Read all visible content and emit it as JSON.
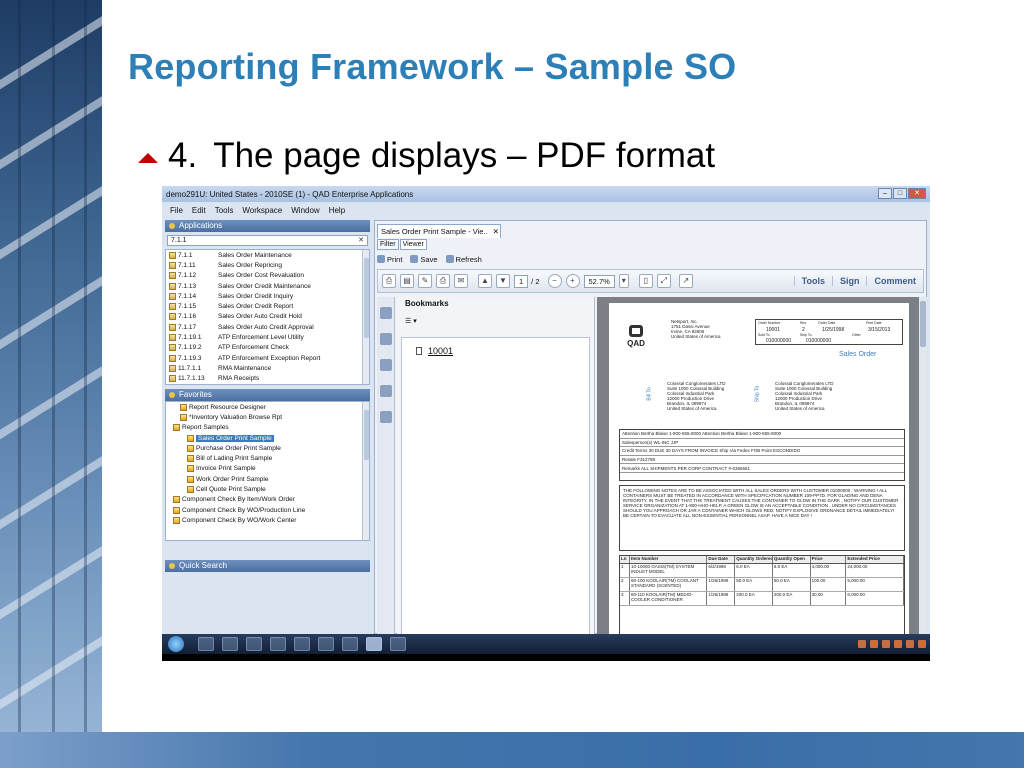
{
  "slide": {
    "title": "Reporting Framework – Sample SO",
    "bullet_number": "4.",
    "bullet_text": "The page displays – PDF format"
  },
  "app": {
    "window_title": "demo291U: United States - 2010SE (1) - QAD Enterprise Applications",
    "menu": [
      "File",
      "Edit",
      "Tools",
      "Workspace",
      "Window",
      "Help"
    ],
    "applications_header": "Applications",
    "search_value": "7.1.1",
    "applications": [
      {
        "code": "7.1.1",
        "label": "Sales Order Maintenance"
      },
      {
        "code": "7.1.11",
        "label": "Sales Order Repricing"
      },
      {
        "code": "7.1.12",
        "label": "Sales Order Cost Revaluation"
      },
      {
        "code": "7.1.13",
        "label": "Sales Order Credit Maintenance"
      },
      {
        "code": "7.1.14",
        "label": "Sales Order Credit Inquiry"
      },
      {
        "code": "7.1.15",
        "label": "Sales Order Credit Report"
      },
      {
        "code": "7.1.16",
        "label": "Sales Order Auto Credit Hold"
      },
      {
        "code": "7.1.17",
        "label": "Sales Order Auto Credit Approval"
      },
      {
        "code": "7.1.19.1",
        "label": "ATP Enforcement Level Utility"
      },
      {
        "code": "7.1.19.2",
        "label": "ATP Enforcement Check"
      },
      {
        "code": "7.1.19.3",
        "label": "ATP Enforcement Exception Report"
      },
      {
        "code": "11.7.1.1",
        "label": "RMA Maintenance"
      },
      {
        "code": "11.7.1.13",
        "label": "RMA Receipts"
      }
    ],
    "favorites_header": "Favorites",
    "favorites": [
      {
        "label": "Report Resource Designer",
        "indent": 1
      },
      {
        "label": "*Inventory Valuation Browse Rpt",
        "indent": 1
      },
      {
        "label": "Report Samples",
        "indent": 0
      },
      {
        "label": "Sales Order Print Sample",
        "indent": 2,
        "selected": true
      },
      {
        "label": "Purchase Order Print Sample",
        "indent": 2
      },
      {
        "label": "Bill of Lading Print Sample",
        "indent": 2
      },
      {
        "label": "Invoice Print Sample",
        "indent": 2
      },
      {
        "label": "Work Order Print Sample",
        "indent": 2
      },
      {
        "label": "Cell Quote Print Sample",
        "indent": 2
      },
      {
        "label": "Component Check By Item/Work Order",
        "indent": 0
      },
      {
        "label": "Component Check By WO/Production Line",
        "indent": 0
      },
      {
        "label": "Component Check By WO/Work Center",
        "indent": 0
      }
    ],
    "quick_search_header": "Quick Search",
    "tab_label": "Sales Order Print Sample - Vie..",
    "tab_close": "✕",
    "filter_label": "Filter",
    "viewer_label": "Viewer",
    "actions": [
      "Print",
      "Save",
      "Refresh"
    ],
    "pdf_page_current": "1",
    "pdf_page_total": "/ 2",
    "pdf_zoom": "52.7%",
    "pdf_tools": [
      "Tools",
      "Sign",
      "Comment"
    ],
    "bookmarks_header": "Bookmarks",
    "bookmark_node": "10001"
  },
  "doc": {
    "logo_text": "QAD",
    "company_addr": [
      "Netsport, Inc.",
      "1751 Dassi Avenue",
      "Irvine, CA 92606",
      "United States of America"
    ],
    "order_no_label": "Order Number",
    "order_no": "10001",
    "rev_label": "Rev",
    "rev": "2",
    "order_date_label": "Order Date",
    "order_date": "1/25/1998",
    "print_date_label": "Print Date",
    "print_date": "3/15/2013",
    "sold_to_label": "Sold To",
    "sold_to": "010000000",
    "ship_to_label": "Ship To",
    "ship_to": "010000000",
    "other_label": "Other",
    "doc_title": "Sales Order",
    "bill_vertical": "Bill To",
    "ship_vertical": "Ship To",
    "bill_addr": [
      "Colossal Conglomerates LTD",
      "Suite 1000 Colossal Building",
      "Colossal Industrial Park",
      "12000 Production Drive",
      "Brandon, IL 099974",
      "United States of America"
    ],
    "ship_addr": [
      "Colossal Conglomerates LTD",
      "Suite 1000 Colossal Building",
      "Colossal Industrial Park",
      "12000 Production Drive",
      "Brandon, IL 099974",
      "United States of America"
    ],
    "info_rows": [
      "Attention    Bertha Blaise   1-800-555-8000     Attention    Bertha Blaise  1-800-555-8000",
      "Salesperson(s)    WL-INC    JJP",
      "Credit Terms    30   DUE 30 DAYS FROM INVOICE    Ship Via  Fedex    FOB Point  ESCONDIDO",
      "Resale    F312768",
      "Remarks    ALL SHIPMENTS PER CORP CONTRACT #-0356551"
    ],
    "notes": "THE FOLLOWING NOTES ARE TO BE ASSOCIATED WITH ALL SALES ORDERS WITH CUSTOMER 01000000 : WARNING ! ALL CONTAINERS MUST BE TREATED IN ACCORDANCE WITH SPECIFICATION NUMBER 109-PP7D. FOR GLADING AND DENA INTEGRITY. IN THE EVENT THAT THE TREATMENT CAUSES THE CONTAINER TO GLOW IN THE DARK , NOTIFY OUR CUSTOMER SERVICE ORGANIZATION AT 1-800-HHO-HELP. A GREEN GLOW IS AN ACCEPTABLE CONDITION . UNDER NO CIRCUMSTANCES SHOULD YOU APPROACH OR JAR A CONTAINER WHICH GLOWS RED. NOTIFY EXPLOSIVE ORDNANCE DETAIL IMMEDIATELY! BE CERTAIN TO EVACUATE ALL NON-ESSENTIAL PERSONNEL ASAP. HAVE A NICE DAY !",
    "line_headers": [
      "Ln",
      "Item Number",
      "Due Date",
      "Quantity Ordered",
      "Quantity Open",
      "Price",
      "Extended Price"
    ],
    "line_rows": [
      [
        "1",
        "10-10000  OASIS(TM) SYSTEM INDUST MODEL",
        "6/2/1998",
        "6.0  EA",
        "6.0  EA",
        "4,000.00",
        "24,000.00"
      ],
      [
        "2",
        "60-100  KOOLAIR(TM) COOLANT STANDARD (SCENTED)",
        "1/26/1998",
        "50.0  EA",
        "50.0  EA",
        "100.00",
        "5,000.00"
      ],
      [
        "3",
        "60-110  KOOLAIR(TM) MEDIO-COOLER CONDITIONER",
        "1/26/1998",
        "200.0  EA",
        "200.0  EA",
        "30.00",
        "6,000.00"
      ]
    ]
  },
  "colors": {
    "title": "#2d7fb8",
    "bullet_marker": "#c00000",
    "selection": "#3c79c6"
  }
}
